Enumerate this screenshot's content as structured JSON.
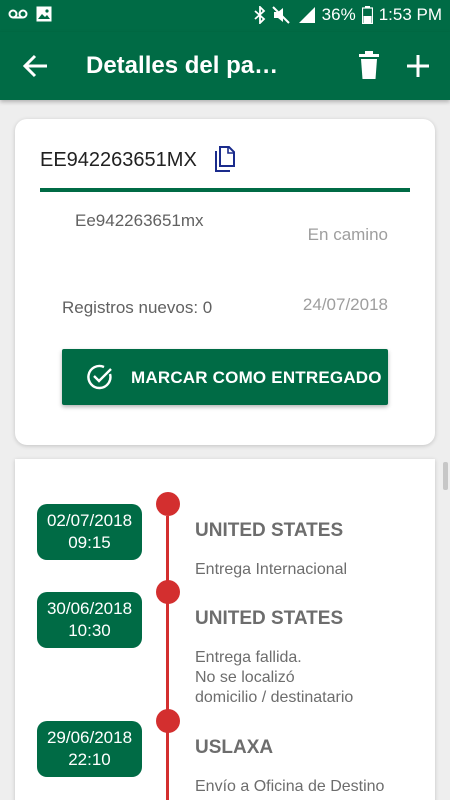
{
  "status_bar": {
    "battery": "36%",
    "time": "1:53 PM"
  },
  "app_bar": {
    "title": "Detalles del pa…"
  },
  "package": {
    "tracking_code": "EE942263651MX",
    "alias": "Ee942263651mx",
    "status": "En camino",
    "new_records": "Registros nuevos: 0",
    "date": "24/07/2018",
    "deliver_button_label": "MARCAR COMO ENTREGADO"
  },
  "timeline": [
    {
      "date": "02/07/2018",
      "time": "09:15",
      "location": "UNITED STATES",
      "description": "Entrega Internacional"
    },
    {
      "date": "30/06/2018",
      "time": "10:30",
      "location": "UNITED STATES",
      "description": "Entrega fallida.\nNo se localizó\ndomicilio / destinatario"
    },
    {
      "date": "29/06/2018",
      "time": "22:10",
      "location": "USLAXA",
      "description": "Envío a Oficina de Destino"
    }
  ],
  "colors": {
    "primary": "#006b45",
    "timeline": "#d32f2f",
    "copy_icon": "#1a2b8c"
  }
}
